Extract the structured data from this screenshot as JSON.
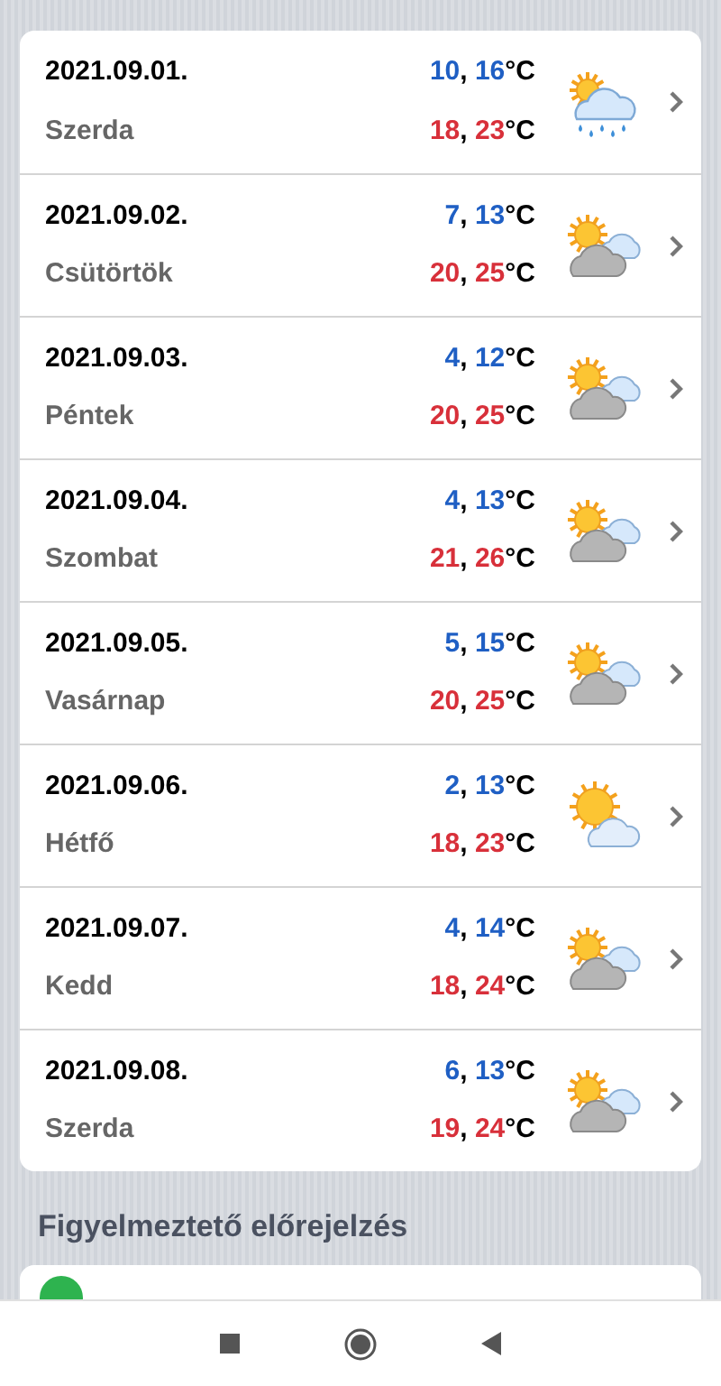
{
  "forecast": [
    {
      "date": "2021.09.01.",
      "day": "Szerda",
      "low": {
        "values": [
          "10",
          "16"
        ],
        "separator": ",",
        "unit": "°C"
      },
      "high": {
        "values": [
          "18",
          "23"
        ],
        "separator": ",",
        "unit": "°C"
      },
      "kind": "rain"
    },
    {
      "date": "2021.09.02.",
      "day": "Csütörtök",
      "low": {
        "values": [
          "7",
          "13"
        ],
        "separator": ",",
        "unit": "°C"
      },
      "high": {
        "values": [
          "20",
          "25"
        ],
        "separator": ",",
        "unit": "°C"
      },
      "kind": "cloudy"
    },
    {
      "date": "2021.09.03.",
      "day": "Péntek",
      "low": {
        "values": [
          "4",
          "12"
        ],
        "separator": ",",
        "unit": "°C"
      },
      "high": {
        "values": [
          "20",
          "25"
        ],
        "separator": ",",
        "unit": "°C"
      },
      "kind": "cloudy"
    },
    {
      "date": "2021.09.04.",
      "day": "Szombat",
      "low": {
        "values": [
          "4",
          "13"
        ],
        "separator": ",",
        "unit": "°C"
      },
      "high": {
        "values": [
          "21",
          "26"
        ],
        "separator": ",",
        "unit": "°C"
      },
      "kind": "cloudy"
    },
    {
      "date": "2021.09.05.",
      "day": "Vasárnap",
      "low": {
        "values": [
          "5",
          "15"
        ],
        "separator": ",",
        "unit": "°C"
      },
      "high": {
        "values": [
          "20",
          "25"
        ],
        "separator": ",",
        "unit": "°C"
      },
      "kind": "cloudy"
    },
    {
      "date": "2021.09.06.",
      "day": "Hétfő",
      "low": {
        "values": [
          "2",
          "13"
        ],
        "separator": ",",
        "unit": "°C"
      },
      "high": {
        "values": [
          "18",
          "23"
        ],
        "separator": ",",
        "unit": "°C"
      },
      "kind": "sunny"
    },
    {
      "date": "2021.09.07.",
      "day": "Kedd",
      "low": {
        "values": [
          "4",
          "14"
        ],
        "separator": ",",
        "unit": "°C"
      },
      "high": {
        "values": [
          "18",
          "24"
        ],
        "separator": ",",
        "unit": "°C"
      },
      "kind": "cloudy"
    },
    {
      "date": "2021.09.08.",
      "day": "Szerda",
      "low": {
        "values": [
          "6",
          "13"
        ],
        "separator": ",",
        "unit": "°C"
      },
      "high": {
        "values": [
          "19",
          "24"
        ],
        "separator": ",",
        "unit": "°C"
      },
      "kind": "cloudy"
    }
  ],
  "warning_section": {
    "title": "Figyelmeztető előrejelzés",
    "items": [
      {
        "color": "#2eb34f"
      }
    ]
  }
}
